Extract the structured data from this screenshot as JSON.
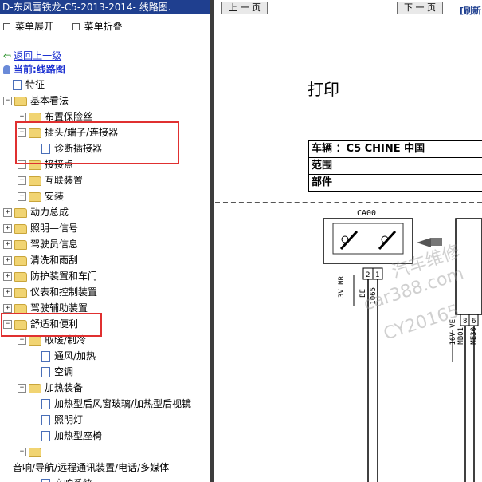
{
  "window_title": "D-东风雪铁龙-C5-2013-2014- 线路图.",
  "menu": {
    "expand": "菜单展开",
    "collapse": "菜单折叠"
  },
  "nav": {
    "back": "返回上一级",
    "current": "当前:线路图"
  },
  "tree": [
    {
      "label": "特征",
      "indent": 0,
      "icon": "doc",
      "toggle": ""
    },
    {
      "label": "基本看法",
      "indent": 0,
      "icon": "folder",
      "toggle": "-"
    },
    {
      "label": "布置保险丝",
      "indent": 1,
      "icon": "folder",
      "toggle": "+"
    },
    {
      "label": "插头/端子/连接器",
      "indent": 1,
      "icon": "folder",
      "toggle": "-"
    },
    {
      "label": "诊断插接器",
      "indent": 2,
      "icon": "doc",
      "toggle": ""
    },
    {
      "label": "接接点",
      "indent": 1,
      "icon": "folder",
      "toggle": "+"
    },
    {
      "label": "互联装置",
      "indent": 1,
      "icon": "folder",
      "toggle": "+"
    },
    {
      "label": "安装",
      "indent": 1,
      "icon": "folder",
      "toggle": "+"
    },
    {
      "label": "动力总成",
      "indent": 0,
      "icon": "folder",
      "toggle": "+"
    },
    {
      "label": "照明—信号",
      "indent": 0,
      "icon": "folder",
      "toggle": "+"
    },
    {
      "label": "驾驶员信息",
      "indent": 0,
      "icon": "folder",
      "toggle": "+"
    },
    {
      "label": "清洗和雨刮",
      "indent": 0,
      "icon": "folder",
      "toggle": "+"
    },
    {
      "label": "防护装置和车门",
      "indent": 0,
      "icon": "folder",
      "toggle": "+"
    },
    {
      "label": "仪表和控制装置",
      "indent": 0,
      "icon": "folder",
      "toggle": "+"
    },
    {
      "label": "驾驶辅助装置",
      "indent": 0,
      "icon": "folder",
      "toggle": "+"
    },
    {
      "label": "舒适和便利",
      "indent": 0,
      "icon": "folder",
      "toggle": "-"
    },
    {
      "label": "取暖/制冷",
      "indent": 1,
      "icon": "folder",
      "toggle": "-"
    },
    {
      "label": "通风/加热",
      "indent": 2,
      "icon": "doc",
      "toggle": ""
    },
    {
      "label": "空调",
      "indent": 2,
      "icon": "doc",
      "toggle": ""
    },
    {
      "label": "加热装备",
      "indent": 1,
      "icon": "folder",
      "toggle": "-"
    },
    {
      "label": "加热型后风窗玻璃/加热型后视镜",
      "indent": 2,
      "icon": "doc",
      "toggle": ""
    },
    {
      "label": "照明灯",
      "indent": 2,
      "icon": "doc",
      "toggle": ""
    },
    {
      "label": "加热型座椅",
      "indent": 2,
      "icon": "doc",
      "toggle": ""
    },
    {
      "label": "",
      "indent": 1,
      "icon": "folder",
      "toggle": "-"
    },
    {
      "label": "音响/导航/远程通讯装置/电话/多媒体",
      "indent": 0,
      "icon": "none",
      "toggle": ""
    },
    {
      "label": "音响系统",
      "indent": 2,
      "icon": "doc",
      "toggle": ""
    }
  ],
  "viewer": {
    "prev": "上 一 页",
    "next": "下 一 页",
    "refresh": "[刷新",
    "print_label": "打印",
    "vehicle": "车辆 ：C5 CHINE 中国",
    "scope": "范围",
    "part": "部件",
    "connector": "CA00",
    "watermark1": "汽车维修",
    "watermark2": "car388.com",
    "watermark3": "CY20165",
    "wire_labels": [
      "3V NR",
      "BE",
      "1065",
      "16V VE",
      "MB01",
      "ME30"
    ]
  },
  "colors": {
    "title_bg": "#1f3f8f",
    "highlight_border": "#e03030",
    "link": "#1a2fd1"
  }
}
